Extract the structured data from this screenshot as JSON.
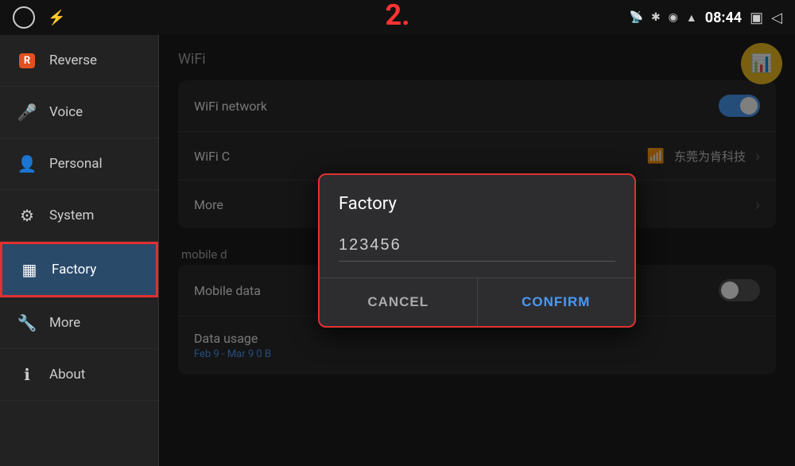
{
  "statusBar": {
    "leftIcons": [
      "circle-icon",
      "usb-icon"
    ],
    "stepNumber": "2.",
    "rightIcons": [
      "cast-icon",
      "bluetooth-icon",
      "location-icon",
      "wifi-icon"
    ],
    "time": "08:44",
    "windowIcon": "▣",
    "backIcon": "◁"
  },
  "sidebar": {
    "items": [
      {
        "id": "reverse",
        "label": "Reverse",
        "icon": "R"
      },
      {
        "id": "voice",
        "label": "Voice",
        "icon": "🎤"
      },
      {
        "id": "personal",
        "label": "Personal",
        "icon": "👤"
      },
      {
        "id": "system",
        "label": "System",
        "icon": "⚙"
      },
      {
        "id": "factory",
        "label": "Factory",
        "icon": "▦",
        "active": true
      },
      {
        "id": "more",
        "label": "More",
        "icon": "🔧"
      },
      {
        "id": "about",
        "label": "About",
        "icon": "ℹ"
      }
    ]
  },
  "content": {
    "sectionTitle": "WiFi",
    "wifiNetworkLabel": "WiFi network",
    "wifiConnectedLabel": "WiFi C",
    "wifiName": "东莞为肯科技",
    "moreLabel": "More",
    "mobileDataLabel": "mobile d",
    "mobileDataFullLabel": "Mobile data",
    "dataUsageLabel": "Data usage",
    "dataUsageSub": "Feb 9 - Mar 9 0 B"
  },
  "dialog": {
    "title": "Factory",
    "inputValue": "123456",
    "cancelLabel": "CANCEL",
    "confirmLabel": "CONFIRM"
  }
}
